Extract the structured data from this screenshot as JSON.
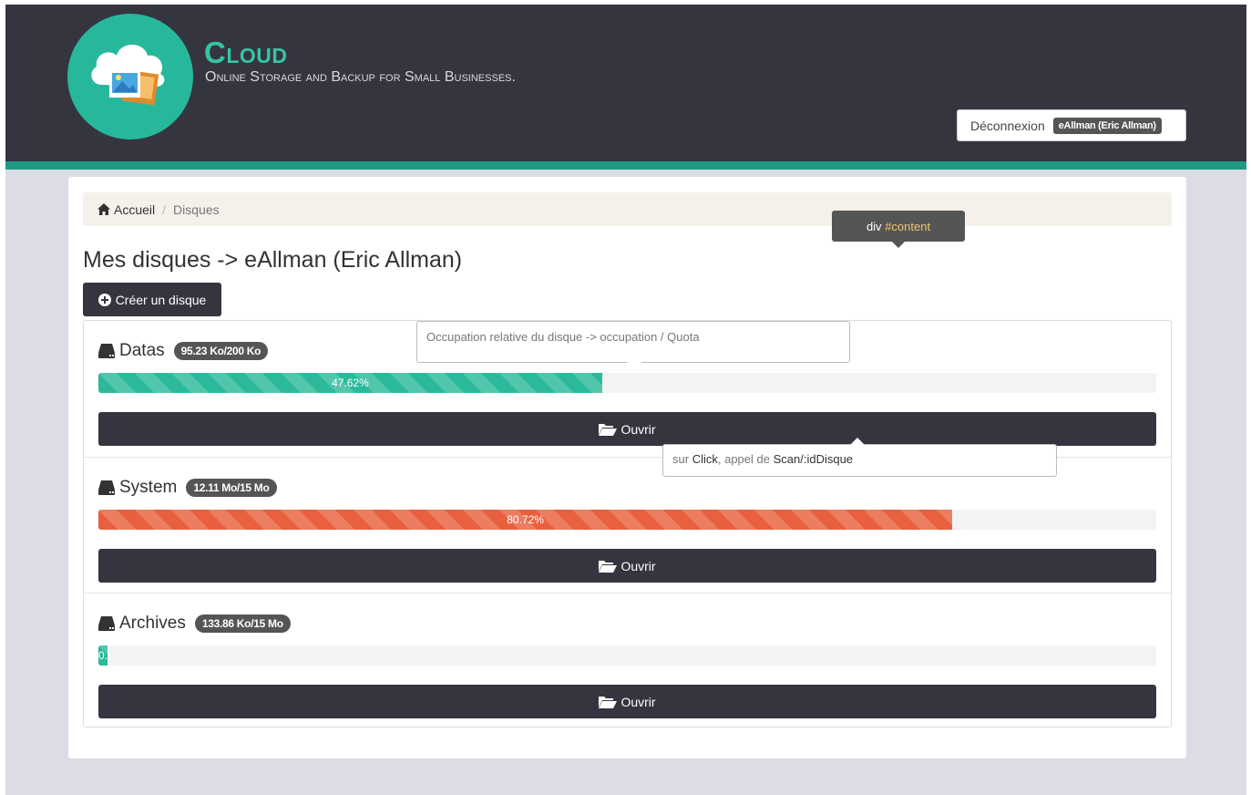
{
  "header": {
    "brand_title": "Cloud",
    "brand_tagline": "Online Storage and Backup for Small Businesses.",
    "logout_label": "Déconnexion",
    "user_badge": "eAllman (Eric Allman)"
  },
  "breadcrumb": {
    "home": "Accueil",
    "separator": "/",
    "current": "Disques"
  },
  "page": {
    "title": "Mes disques -> eAllman (Eric Allman)",
    "create_button": "Créer un disque"
  },
  "disks": [
    {
      "name": "Datas",
      "usage": "95.23 Ko/200 Ko",
      "percent": 47.62,
      "percent_label": "47.62%",
      "color": "#2bb99a",
      "open_label": "Ouvrir"
    },
    {
      "name": "System",
      "usage": "12.11 Mo/15 Mo",
      "percent": 80.72,
      "percent_label": "80.72%",
      "color": "#e8603e",
      "open_label": "Ouvrir"
    },
    {
      "name": "Archives",
      "usage": "133.86 Ko/15 Mo",
      "percent": 0.87,
      "percent_label": "0.87%",
      "color": "#2bb99a",
      "open_label": "Ouvrir"
    }
  ],
  "annotations": {
    "content_div_prefix": "div",
    "content_div_id": "#content",
    "occupation_note": "Occupation relative du disque -> occupation / Quota",
    "click_note": {
      "p1": "sur",
      "p2": "Click",
      "p3": ", appel de",
      "p4": "Scan/:idDisque"
    }
  },
  "colors": {
    "header_bg": "#353540",
    "accent": "#1e9a85",
    "logo": "#27b89c",
    "button_bg": "#353540"
  },
  "icons": {
    "logo": "cloud-photo-icon",
    "home": "home-icon",
    "create": "plus-circle-icon",
    "disk": "hdd-icon",
    "open": "folder-open-icon"
  }
}
